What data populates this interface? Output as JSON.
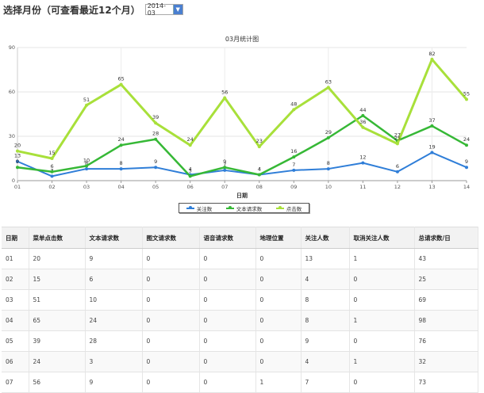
{
  "header": {
    "label": "选择月份（可查看最近12个月）",
    "month_value": "2014-03"
  },
  "chart_data": {
    "type": "line",
    "title": "03月统计图",
    "xlabel": "日期",
    "ylabel": "",
    "categories": [
      "01",
      "02",
      "03",
      "04",
      "05",
      "06",
      "07",
      "08",
      "09",
      "10",
      "11",
      "12",
      "13",
      "14"
    ],
    "ylim": [
      0,
      90
    ],
    "yticks": [
      0,
      30,
      60,
      90
    ],
    "series": [
      {
        "name": "关注数",
        "color": "#2f7ed8",
        "values": [
          13,
          3,
          8,
          8,
          9,
          4,
          7,
          4,
          7,
          8,
          12,
          6,
          19,
          9
        ]
      },
      {
        "name": "文本请求数",
        "color": "#36b836",
        "values": [
          9,
          6,
          10,
          24,
          28,
          3,
          9,
          4,
          16,
          29,
          44,
          27,
          37,
          24
        ]
      },
      {
        "name": "点击数",
        "color": "#a8e03a",
        "values": [
          20,
          15,
          51,
          65,
          39,
          24,
          56,
          23,
          48,
          63,
          36,
          25,
          82,
          55
        ]
      }
    ]
  },
  "table": {
    "headers": [
      "日期",
      "菜单点击数",
      "文本请求数",
      "图文请求数",
      "语音请求数",
      "地理位置",
      "关注人数",
      "取消关注人数",
      "总请求数/日"
    ],
    "rows": [
      [
        "01",
        "20",
        "9",
        "0",
        "0",
        "0",
        "13",
        "1",
        "43"
      ],
      [
        "02",
        "15",
        "6",
        "0",
        "0",
        "0",
        "4",
        "0",
        "25"
      ],
      [
        "03",
        "51",
        "10",
        "0",
        "0",
        "0",
        "8",
        "0",
        "69"
      ],
      [
        "04",
        "65",
        "24",
        "0",
        "0",
        "0",
        "8",
        "1",
        "98"
      ],
      [
        "05",
        "39",
        "28",
        "0",
        "0",
        "0",
        "9",
        "0",
        "76"
      ],
      [
        "06",
        "24",
        "3",
        "0",
        "0",
        "0",
        "4",
        "1",
        "32"
      ],
      [
        "07",
        "56",
        "9",
        "0",
        "0",
        "1",
        "7",
        "0",
        "73"
      ]
    ]
  }
}
